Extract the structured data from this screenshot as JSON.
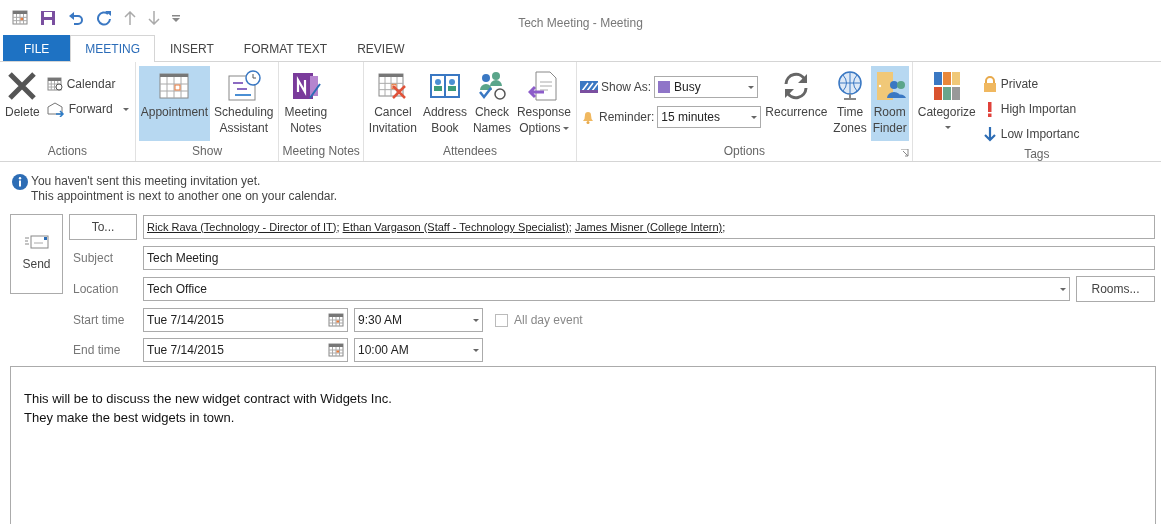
{
  "window": {
    "title": "Tech Meeting - Meeting"
  },
  "tabs": [
    {
      "label": "FILE",
      "kind": "file",
      "selected": false
    },
    {
      "label": "MEETING",
      "kind": "tab",
      "selected": true
    },
    {
      "label": "INSERT",
      "kind": "tab",
      "selected": false
    },
    {
      "label": "FORMAT TEXT",
      "kind": "tab",
      "selected": false
    },
    {
      "label": "REVIEW",
      "kind": "tab",
      "selected": false
    }
  ],
  "ribbon": {
    "groups": [
      {
        "label": "Actions",
        "launcher": false,
        "items": [
          {
            "kind": "large",
            "label": "Delete",
            "on": false,
            "has_menu": false
          },
          {
            "kind": "small",
            "label": "Calendar",
            "on": false,
            "has_menu": false
          },
          {
            "kind": "small",
            "label": "Forward",
            "on": false,
            "has_menu": true
          }
        ]
      },
      {
        "label": "Show",
        "launcher": false,
        "items": [
          {
            "kind": "large",
            "label": "Appointment",
            "on": true,
            "has_menu": false
          },
          {
            "kind": "large",
            "label": "Scheduling Assistant",
            "on": false,
            "has_menu": false
          }
        ]
      },
      {
        "label": "Meeting Notes",
        "launcher": false,
        "items": [
          {
            "kind": "large",
            "label": "Meeting Notes",
            "on": false,
            "has_menu": false
          }
        ]
      },
      {
        "label": "Attendees",
        "launcher": false,
        "items": [
          {
            "kind": "large",
            "label": "Cancel Invitation",
            "on": false,
            "has_menu": false
          },
          {
            "kind": "large",
            "label": "Address Book",
            "on": false,
            "has_menu": false
          },
          {
            "kind": "large",
            "label": "Check Names",
            "on": false,
            "has_menu": false
          },
          {
            "kind": "large",
            "label": "Response Options",
            "on": false,
            "has_menu": true
          }
        ]
      },
      {
        "label": "Options",
        "launcher": true,
        "items": [
          {
            "kind": "field",
            "label": "Show As:",
            "value": "Busy",
            "color": "#8f75c8"
          },
          {
            "kind": "field",
            "label": "Reminder:",
            "value": "15 minutes"
          },
          {
            "kind": "large",
            "label": "Recurrence",
            "on": false,
            "has_menu": false
          },
          {
            "kind": "large",
            "label": "Time Zones",
            "on": false,
            "has_menu": false
          },
          {
            "kind": "large",
            "label": "Room Finder",
            "on": true,
            "has_menu": false
          }
        ]
      },
      {
        "label": "Tags",
        "launcher": false,
        "items": [
          {
            "kind": "large",
            "label": "Categorize",
            "on": false,
            "has_menu": true
          },
          {
            "kind": "small",
            "label": "Private",
            "on": false,
            "has_menu": false
          },
          {
            "kind": "small",
            "label": "High Importan",
            "on": false,
            "has_menu": false
          },
          {
            "kind": "small",
            "label": "Low Importanc",
            "on": false,
            "has_menu": false
          }
        ]
      }
    ]
  },
  "info": [
    "You haven't sent this meeting invitation yet.",
    "This appointment is next to another one on your calendar."
  ],
  "form": {
    "send_button": "Send",
    "to_button": "To...",
    "recipients": [
      {
        "name": "Rick Rava (Technology - Director of IT)",
        "separator": ";"
      },
      {
        "name": "Ethan Vargason (Staff - Technology Specialist)",
        "separator": ";"
      },
      {
        "name": "James Misner (College Intern)",
        "separator": ";"
      }
    ],
    "subject": {
      "label": "Subject",
      "value": "Tech Meeting"
    },
    "location": {
      "label": "Location",
      "value": "Tech Office",
      "button": "Rooms..."
    },
    "start": {
      "label": "Start time",
      "date": "Tue 7/14/2015",
      "time": "9:30 AM"
    },
    "all_day": {
      "label": "All day event",
      "checked": false
    },
    "end": {
      "label": "End time",
      "date": "Tue 7/14/2015",
      "time": "10:00 AM"
    }
  },
  "body": [
    "This will be to discuss the new widget contract with Widgets Inc.",
    "They make the best widgets in town."
  ]
}
